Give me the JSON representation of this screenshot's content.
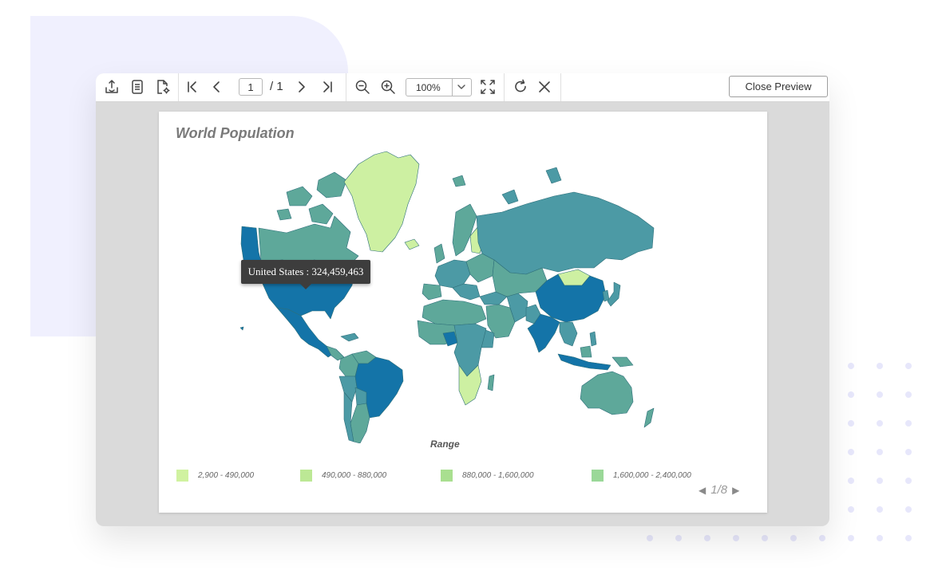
{
  "toolbar": {
    "page_number": "1",
    "page_total": "/ 1",
    "zoom": "100%",
    "close_label": "Close Preview"
  },
  "report": {
    "title": "World Population"
  },
  "map": {
    "tooltip": "United States : 324,459,463",
    "legend_title": "Range",
    "legend": [
      {
        "label": "2,900 - 490,000",
        "color": "#d0f2a0"
      },
      {
        "label": "490,000 - 880,000",
        "color": "#bce895"
      },
      {
        "label": "880,000 - 1,600,000",
        "color": "#a9df90"
      },
      {
        "label": "1,600,000 - 2,400,000",
        "color": "#9ad898"
      }
    ],
    "legend_page": "1/8"
  },
  "colors": {
    "dark_blue": "#1474a8",
    "teal": "#4c9aa5",
    "sea_green": "#5ea89a",
    "light_green": "#cdf0a2"
  }
}
